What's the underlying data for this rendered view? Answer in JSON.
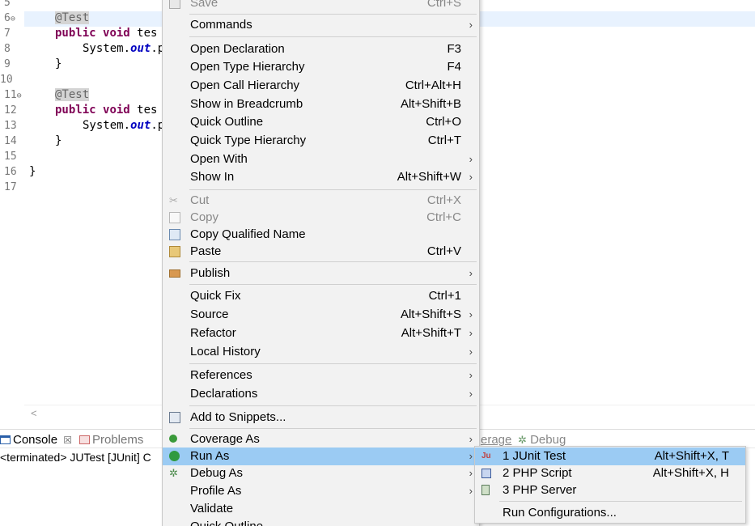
{
  "editor": {
    "lines": [
      {
        "num": "5",
        "fold": ""
      },
      {
        "num": "6",
        "fold": "⊖"
      },
      {
        "num": "7",
        "fold": ""
      },
      {
        "num": "8",
        "fold": ""
      },
      {
        "num": "9",
        "fold": ""
      },
      {
        "num": "10",
        "fold": ""
      },
      {
        "num": "11",
        "fold": "⊖"
      },
      {
        "num": "12",
        "fold": ""
      },
      {
        "num": "13",
        "fold": ""
      },
      {
        "num": "14",
        "fold": ""
      },
      {
        "num": "15",
        "fold": ""
      },
      {
        "num": "16",
        "fold": ""
      },
      {
        "num": "17",
        "fold": ""
      }
    ],
    "code": {
      "l6_annotation": "@Test",
      "l7_kw1": "public",
      "l7_kw2": "void",
      "l7_rest": " tes",
      "l8_pre": "System.",
      "l8_field": "out",
      "l8_post": ".p",
      "l9": "}",
      "l11_annotation": "@Test",
      "l12_kw1": "public",
      "l12_kw2": "void",
      "l12_rest": " tes",
      "l13_pre": "System.",
      "l13_field": "out",
      "l13_post": ".p",
      "l14": "}",
      "l16": "}"
    },
    "hscroll_left": "<"
  },
  "panel": {
    "tabs": {
      "console": "Console",
      "console_close": "☒",
      "problems": "Problems",
      "coverage": "erage",
      "debug": "Debug"
    },
    "status": "<terminated> JUTest [JUnit] C"
  },
  "context_menu": {
    "save": "Save",
    "save_acc": "Ctrl+S",
    "commands": "Commands",
    "open_declaration": "Open Declaration",
    "open_declaration_acc": "F3",
    "open_type_hierarchy": "Open Type Hierarchy",
    "open_type_hierarchy_acc": "F4",
    "open_call_hierarchy": "Open Call Hierarchy",
    "open_call_hierarchy_acc": "Ctrl+Alt+H",
    "show_in_breadcrumb": "Show in Breadcrumb",
    "show_in_breadcrumb_acc": "Alt+Shift+B",
    "quick_outline": "Quick Outline",
    "quick_outline_acc": "Ctrl+O",
    "quick_type_hierarchy": "Quick Type Hierarchy",
    "quick_type_hierarchy_acc": "Ctrl+T",
    "open_with": "Open With",
    "show_in": "Show In",
    "show_in_acc": "Alt+Shift+W",
    "cut": "Cut",
    "cut_acc": "Ctrl+X",
    "copy": "Copy",
    "copy_acc": "Ctrl+C",
    "copy_qualified_name": "Copy Qualified Name",
    "paste": "Paste",
    "paste_acc": "Ctrl+V",
    "publish": "Publish",
    "quick_fix": "Quick Fix",
    "quick_fix_acc": "Ctrl+1",
    "source": "Source",
    "source_acc": "Alt+Shift+S",
    "refactor": "Refactor",
    "refactor_acc": "Alt+Shift+T",
    "local_history": "Local History",
    "references": "References",
    "declarations": "Declarations",
    "add_to_snippets": "Add to Snippets...",
    "coverage_as": "Coverage As",
    "run_as": "Run As",
    "debug_as": "Debug As",
    "profile_as": "Profile As",
    "validate": "Validate",
    "quick_outline_2": "Quick Outline",
    "submenu_arrow": "›"
  },
  "run_as_submenu": {
    "junit_icon": "Ju",
    "junit": "1 JUnit Test",
    "junit_acc": "Alt+Shift+X, T",
    "php_script": "2 PHP Script",
    "php_script_acc": "Alt+Shift+X, H",
    "php_server": "3 PHP Server",
    "run_configurations": "Run Configurations..."
  },
  "colors": {
    "menu_bg": "#f2f2f2",
    "selection": "#9bcbf3",
    "keyword": "#7f0055",
    "field": "#0000c0",
    "current_line": "#e8f2fe"
  }
}
